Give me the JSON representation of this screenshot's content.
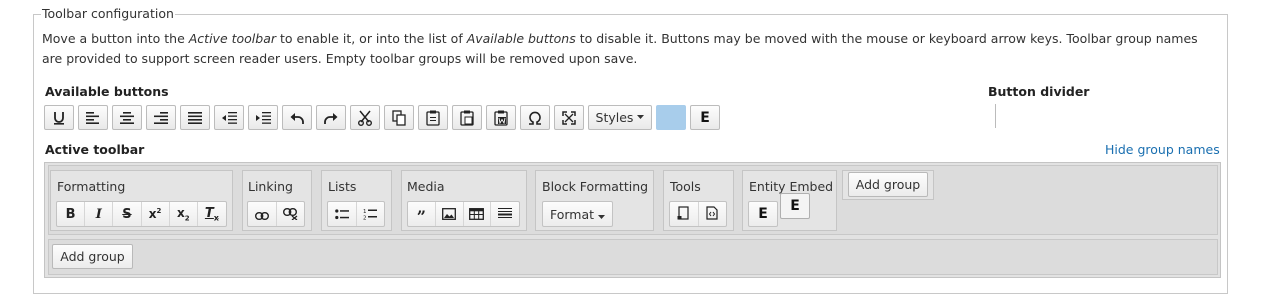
{
  "fieldset": {
    "legend": "Toolbar configuration",
    "description_line1": "Move a button into the Active toolbar to enable it, or into the list of Available buttons to disable it. Buttons may be moved with the mouse or keyboard arrow keys. Toolbar group names",
    "description_line2": "are provided to support screen reader users. Empty toolbar groups will be removed upon save."
  },
  "available": {
    "label": "Available buttons",
    "styles_label": "Styles",
    "entity_label": "E",
    "buttons": [
      "underline-icon",
      "align-left-icon",
      "align-center-icon",
      "align-right-icon",
      "justify-icon",
      "outdent-icon",
      "indent-icon",
      "undo-icon",
      "redo-icon",
      "cut-icon",
      "copy-icon",
      "paste-icon",
      "paste-text-icon",
      "paste-word-icon",
      "special-char-icon",
      "maximize-icon",
      "styles-dropdown",
      "color-swatch",
      "entity-embed-button"
    ],
    "swatch_color": "#a8cdeb"
  },
  "divider": {
    "label": "Button divider"
  },
  "active": {
    "label": "Active toolbar",
    "hide_link": "Hide group names",
    "groups": [
      {
        "name": "Formatting"
      },
      {
        "name": "Linking"
      },
      {
        "name": "Lists"
      },
      {
        "name": "Media"
      },
      {
        "name": "Block Formatting",
        "format_label": "Format"
      },
      {
        "name": "Tools"
      },
      {
        "name": "Entity Embed",
        "button_label": "E",
        "drag_label": "E"
      }
    ],
    "add_group_label": "Add group"
  },
  "colors": {
    "link": "#1a6fb0",
    "toolbar_bg": "#e2e2e2"
  }
}
